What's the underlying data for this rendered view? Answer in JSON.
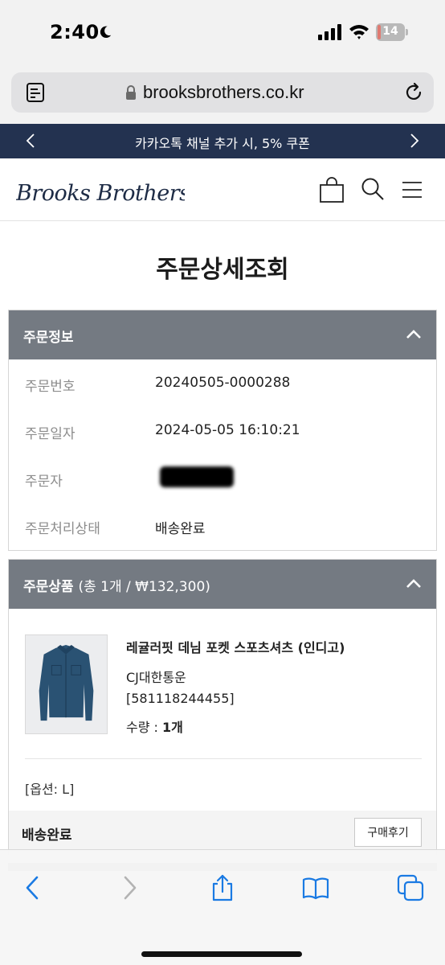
{
  "status_bar": {
    "time": "2:40",
    "battery": "14",
    "battery_level": 0.14
  },
  "browser": {
    "url": "brooksbrothers.co.kr"
  },
  "promo": {
    "text": "카카오톡 채널 추가 시, 5% 쿠폰"
  },
  "header": {
    "logo": "Brooks Brothers"
  },
  "page": {
    "title": "주문상세조회"
  },
  "order_info": {
    "heading": "주문정보",
    "rows": [
      {
        "label": "주문번호",
        "value": "20240505-0000288"
      },
      {
        "label": "주문일자",
        "value": "2024-05-05 16:10:21"
      },
      {
        "label": "주문자",
        "value": ""
      },
      {
        "label": "주문처리상태",
        "value": "배송완료"
      }
    ]
  },
  "order_products": {
    "heading": "주문상품",
    "summary": "(총 1개 / ₩132,300)",
    "item": {
      "name": "레귤러핏 데님 포켓 스포츠셔츠 (인디고)",
      "carrier": "CJ대한통운",
      "tracking": "[581118244455]",
      "qty_label": "수량 : ",
      "qty_value": "1개",
      "option": "[옵션: L]"
    },
    "status": "배송완료",
    "review_button": "구매후기"
  },
  "colors": {
    "navy": "#233250",
    "panel_header": "#747a82",
    "safari_blue": "#1a7ae3"
  },
  "icons": [
    "moon-icon",
    "signal-icon",
    "wifi-icon",
    "battery-icon",
    "reader-icon",
    "lock-icon",
    "reload-icon",
    "chevron-left-icon",
    "chevron-right-icon",
    "shopping-bag-icon",
    "search-icon",
    "menu-icon",
    "chevron-up-icon",
    "share-icon",
    "bookmarks-icon",
    "tabs-icon"
  ]
}
